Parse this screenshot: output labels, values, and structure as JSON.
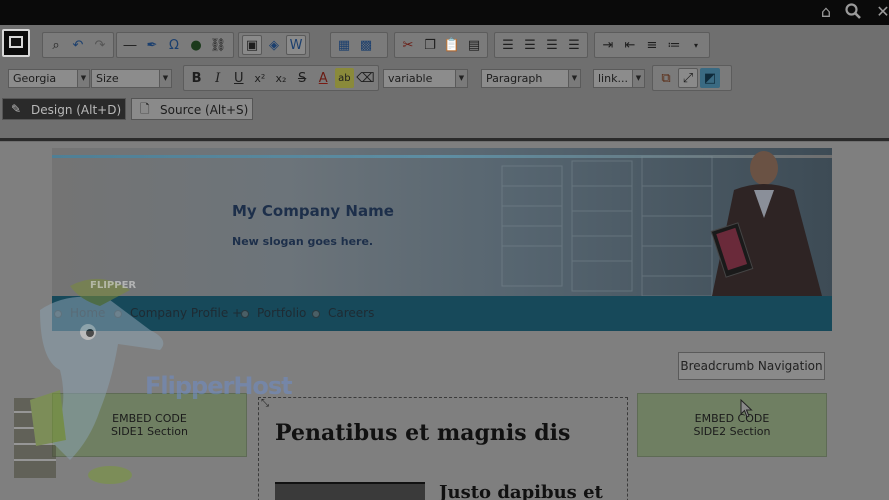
{
  "toolbar": {
    "font_family": "Georgia",
    "font_size": "Size",
    "class_select": "variable",
    "format_select": "Paragraph",
    "link_select": "link..."
  },
  "tabs": {
    "design": "Design (Alt+D)",
    "source": "Source (Alt+S)"
  },
  "page": {
    "company_name": "My Company Name",
    "slogan": "New slogan goes here.",
    "nav": [
      "Home",
      "Company Profile +",
      "Portfolio",
      "Careers"
    ],
    "breadcrumb_button": "Breadcrumb Navigation",
    "embed_left": [
      "EMBED CODE",
      "SIDE1 Section"
    ],
    "embed_right": [
      "EMBED CODE",
      "SIDE2 Section"
    ],
    "heading": "Penatibus et magnis dis",
    "subheading": "Justo dapibus et"
  },
  "watermark": {
    "badge": "FLIPPER",
    "brand": "FlipperHost"
  },
  "colors": {
    "nav_bar": "#17495a",
    "embed_box": "#6f7f62",
    "brand_text": "#1d2f4a"
  }
}
